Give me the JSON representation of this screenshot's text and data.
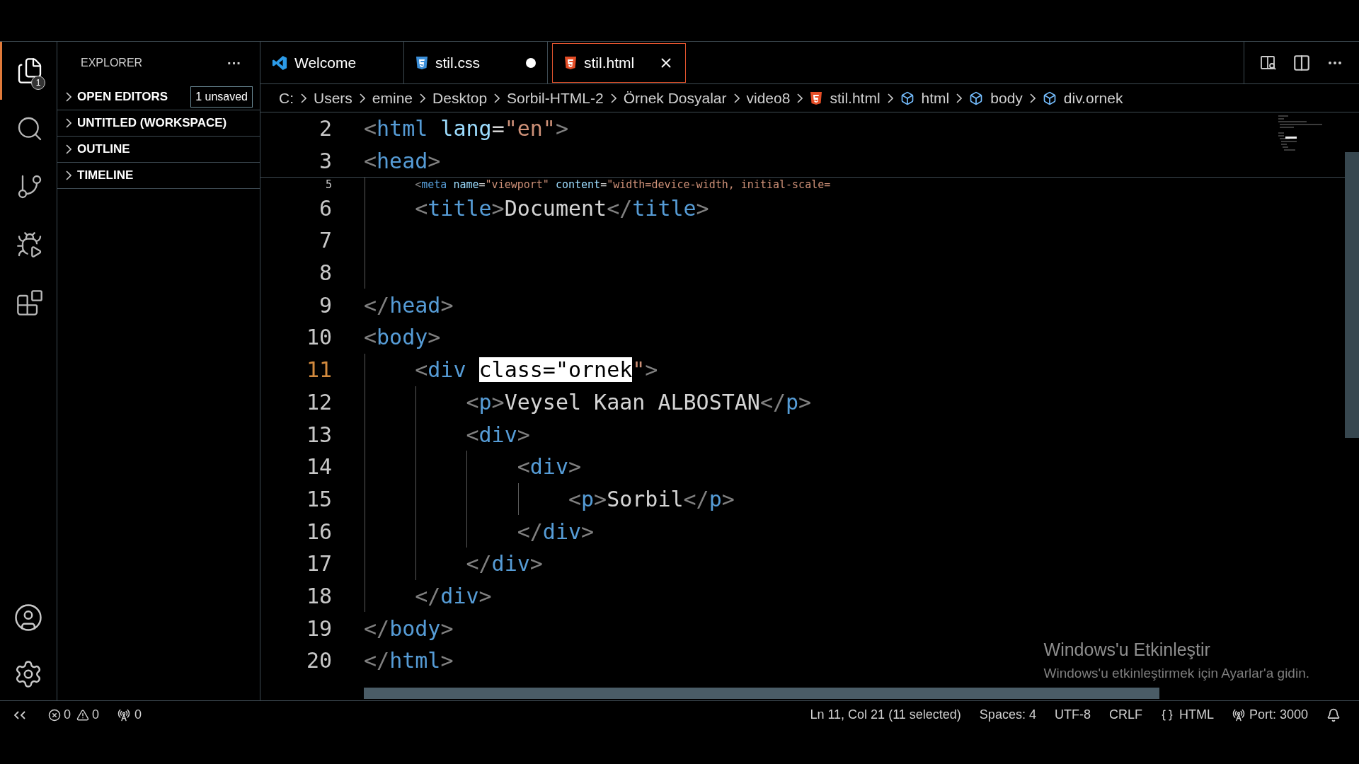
{
  "activity_bar": {
    "items": [
      {
        "kind": "files",
        "selected": true,
        "badge": "1"
      },
      {
        "kind": "search",
        "selected": false
      },
      {
        "kind": "source-control",
        "selected": false
      },
      {
        "kind": "run",
        "selected": false
      },
      {
        "kind": "extensions",
        "selected": false
      }
    ],
    "bottom_items": [
      {
        "kind": "account"
      },
      {
        "kind": "settings"
      }
    ]
  },
  "sidebar": {
    "title": "EXPLORER",
    "more": "···",
    "sections": [
      {
        "label": "OPEN EDITORS",
        "badge": "1 unsaved",
        "expanded": false
      },
      {
        "label": "UNTITLED (WORKSPACE)",
        "expanded": false
      },
      {
        "label": "OUTLINE",
        "expanded": false
      },
      {
        "label": "TIMELINE",
        "expanded": false
      }
    ]
  },
  "tabs": [
    {
      "label": "Welcome",
      "kind": "welcome",
      "selected": false,
      "dirty": false
    },
    {
      "label": "stil.css",
      "kind": "css",
      "selected": false,
      "dirty": true
    },
    {
      "label": "stil.html",
      "kind": "html",
      "selected": true,
      "dirty": false
    }
  ],
  "breadcrumb": [
    {
      "label": "C:",
      "kind": "folder"
    },
    {
      "label": "Users",
      "kind": "folder"
    },
    {
      "label": "emine",
      "kind": "folder"
    },
    {
      "label": "Desktop",
      "kind": "folder"
    },
    {
      "label": "Sorbil-HTML-2",
      "kind": "folder"
    },
    {
      "label": "Örnek Dosyalar",
      "kind": "folder"
    },
    {
      "label": "video8",
      "kind": "folder"
    },
    {
      "label": "stil.html",
      "kind": "file"
    },
    {
      "label": "html",
      "kind": "element"
    },
    {
      "label": "body",
      "kind": "element"
    },
    {
      "label": "div.ornek",
      "kind": "element"
    }
  ],
  "editor": {
    "sticky_lines": [
      {
        "number": "2",
        "active": false,
        "tokens": [
          {
            "kind": "bracket",
            "text": "<"
          },
          {
            "kind": "tag",
            "text": "html"
          },
          {
            "kind": "attr",
            "text": " lang"
          },
          {
            "kind": "text",
            "text": "="
          },
          {
            "kind": "string",
            "text": "\"en\""
          },
          {
            "kind": "bracket",
            "text": ">"
          }
        ]
      },
      {
        "number": "3",
        "active": false,
        "tokens": [
          {
            "kind": "bracket",
            "text": "<"
          },
          {
            "kind": "tag",
            "text": "head"
          },
          {
            "kind": "bracket",
            "text": ">"
          }
        ]
      }
    ],
    "lines": [
      {
        "kind": "continuation",
        "children": [
          {
            "kind": "partial",
            "number": "5",
            "tokens": [
              {
                "kind": "bracket",
                "text": "<"
              },
              {
                "kind": "tag",
                "text": "meta"
              },
              {
                "kind": "attr",
                "text": " name"
              },
              {
                "kind": "text",
                "text": "="
              },
              {
                "kind": "string",
                "text": "\"viewport\""
              },
              {
                "kind": "attr",
                "text": " content"
              },
              {
                "kind": "text",
                "text": "="
              },
              {
                "kind": "string",
                "text": "\"width=device-width, initial-scale="
              }
            ]
          },
          {
            "kind": "line",
            "number": "6",
            "active": false,
            "tokens": [
              {
                "kind": "bracket",
                "text": "<"
              },
              {
                "kind": "tag",
                "text": "title"
              },
              {
                "kind": "bracket",
                "text": ">"
              },
              {
                "kind": "text",
                "text": "Document"
              },
              {
                "kind": "bracket",
                "text": "</"
              },
              {
                "kind": "tag",
                "text": "title"
              },
              {
                "kind": "bracket",
                "text": ">"
              }
            ]
          },
          {
            "kind": "line",
            "number": "7",
            "active": false
          },
          {
            "kind": "line",
            "number": "8",
            "active": false
          }
        ]
      },
      {
        "kind": "line",
        "number": "9",
        "active": false,
        "tokens": [
          {
            "kind": "bracket",
            "text": "</"
          },
          {
            "kind": "tag",
            "text": "head"
          },
          {
            "kind": "bracket",
            "text": ">"
          }
        ]
      },
      {
        "kind": "line",
        "number": "10",
        "active": false,
        "tokens": [
          {
            "kind": "bracket",
            "text": "<"
          },
          {
            "kind": "tag",
            "text": "body"
          },
          {
            "kind": "bracket",
            "text": ">"
          }
        ],
        "children": [
          {
            "kind": "line",
            "number": "11",
            "active": true,
            "tokens": [
              {
                "kind": "bracket",
                "text": "<"
              },
              {
                "kind": "tag",
                "text": "div "
              },
              {
                "kind": "selection",
                "text": "class=\"ornek"
              },
              {
                "kind": "string",
                "text": "\""
              },
              {
                "kind": "bracket",
                "text": ">"
              }
            ],
            "children": [
              {
                "kind": "line",
                "number": "12",
                "active": false,
                "tokens": [
                  {
                    "kind": "bracket",
                    "text": "<"
                  },
                  {
                    "kind": "tag",
                    "text": "p"
                  },
                  {
                    "kind": "bracket",
                    "text": ">"
                  },
                  {
                    "kind": "text",
                    "text": "Veysel Kaan ALBOSTAN"
                  },
                  {
                    "kind": "bracket",
                    "text": "</"
                  },
                  {
                    "kind": "tag",
                    "text": "p"
                  },
                  {
                    "kind": "bracket",
                    "text": ">"
                  }
                ]
              },
              {
                "kind": "line",
                "number": "13",
                "active": false,
                "tokens": [
                  {
                    "kind": "bracket",
                    "text": "<"
                  },
                  {
                    "kind": "tag",
                    "text": "div"
                  },
                  {
                    "kind": "bracket",
                    "text": ">"
                  }
                ],
                "children": [
                  {
                    "kind": "line",
                    "number": "14",
                    "active": false,
                    "tokens": [
                      {
                        "kind": "bracket",
                        "text": "<"
                      },
                      {
                        "kind": "tag",
                        "text": "div"
                      },
                      {
                        "kind": "bracket",
                        "text": ">"
                      }
                    ],
                    "children": [
                      {
                        "kind": "line",
                        "number": "15",
                        "active": false,
                        "tokens": [
                          {
                            "kind": "bracket",
                            "text": "<"
                          },
                          {
                            "kind": "tag",
                            "text": "p"
                          },
                          {
                            "kind": "bracket",
                            "text": ">"
                          },
                          {
                            "kind": "text",
                            "text": "Sorbil"
                          },
                          {
                            "kind": "bracket",
                            "text": "</"
                          },
                          {
                            "kind": "tag",
                            "text": "p"
                          },
                          {
                            "kind": "bracket",
                            "text": ">"
                          }
                        ]
                      }
                    ]
                  },
                  {
                    "kind": "line",
                    "number": "16",
                    "active": false,
                    "tokens": [
                      {
                        "kind": "bracket",
                        "text": "</"
                      },
                      {
                        "kind": "tag",
                        "text": "div"
                      },
                      {
                        "kind": "bracket",
                        "text": ">"
                      }
                    ]
                  }
                ]
              },
              {
                "kind": "line",
                "number": "17",
                "active": false,
                "tokens": [
                  {
                    "kind": "bracket",
                    "text": "</"
                  },
                  {
                    "kind": "tag",
                    "text": "div"
                  },
                  {
                    "kind": "bracket",
                    "text": ">"
                  }
                ]
              }
            ]
          },
          {
            "kind": "line",
            "number": "18",
            "active": false,
            "tokens": [
              {
                "kind": "bracket",
                "text": "</"
              },
              {
                "kind": "tag",
                "text": "div"
              },
              {
                "kind": "bracket",
                "text": ">"
              }
            ]
          }
        ]
      },
      {
        "kind": "line",
        "number": "19",
        "active": false,
        "tokens": [
          {
            "kind": "bracket",
            "text": "</"
          },
          {
            "kind": "tag",
            "text": "body"
          },
          {
            "kind": "bracket",
            "text": ">"
          }
        ]
      },
      {
        "kind": "line",
        "number": "20",
        "active": false,
        "tokens": [
          {
            "kind": "bracket",
            "text": "</"
          },
          {
            "kind": "tag",
            "text": "html"
          },
          {
            "kind": "bracket",
            "text": ">"
          }
        ]
      }
    ]
  },
  "activation_notice": {
    "title": "Windows'u Etkinleştir",
    "subtitle": "Windows'u etkinleştirmek için Ayarlar'a gidin."
  },
  "status_bar": {
    "errors": "0",
    "warnings": "0",
    "ports": "0",
    "right": [
      {
        "kind": "text",
        "text": "Ln 11, Col 21 (11 selected)"
      },
      {
        "kind": "text",
        "text": "Spaces: 4"
      },
      {
        "kind": "text",
        "text": "UTF-8"
      },
      {
        "kind": "text",
        "text": "CRLF"
      },
      {
        "kind": "language",
        "text": "HTML"
      },
      {
        "kind": "port",
        "text": "Port: 3000"
      },
      {
        "kind": "bell"
      }
    ]
  }
}
